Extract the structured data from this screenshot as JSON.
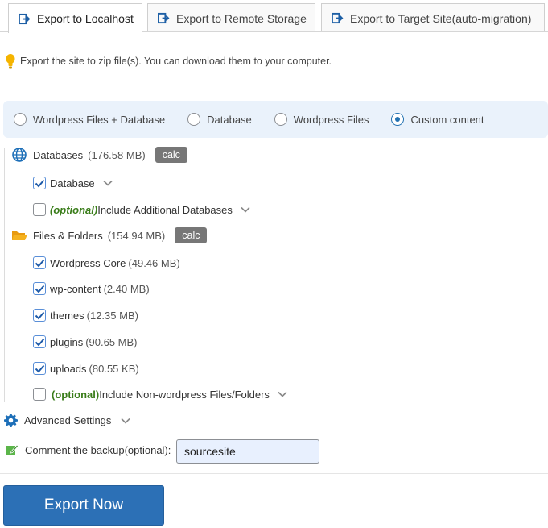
{
  "tabs": [
    {
      "label": "Export to Localhost"
    },
    {
      "label": "Export to Remote Storage"
    },
    {
      "label": "Export to Target Site(auto-migration)"
    }
  ],
  "info_text": "Export the site to zip file(s). You can download them to your computer.",
  "radios": [
    {
      "label": "Wordpress Files + Database",
      "checked": false
    },
    {
      "label": "Database",
      "checked": false
    },
    {
      "label": "Wordpress Files",
      "checked": false
    },
    {
      "label": "Custom content",
      "checked": true
    }
  ],
  "databases": {
    "title": "Databases",
    "size": "(176.58 MB)",
    "calc_label": "calc",
    "items": [
      {
        "label": "Database",
        "checked": true
      },
      {
        "optional": "(optional)",
        "label": "Include Additional Databases",
        "checked": false
      }
    ]
  },
  "files": {
    "title": "Files & Folders",
    "size": "(154.94 MB)",
    "calc_label": "calc",
    "items": [
      {
        "label": "Wordpress Core",
        "size": "(49.46 MB)",
        "checked": true
      },
      {
        "label": "wp-content",
        "size": "(2.40 MB)",
        "checked": true
      },
      {
        "label": "themes",
        "size": "(12.35 MB)",
        "checked": true
      },
      {
        "label": "plugins",
        "size": "(90.65 MB)",
        "checked": true
      },
      {
        "label": "uploads",
        "size": "(80.55 KB)",
        "checked": true
      }
    ],
    "optional_item": {
      "optional": "(optional)",
      "label": "Include Non-wordpress Files/Folders",
      "checked": false
    }
  },
  "advanced_settings": "Advanced Settings",
  "comment": {
    "label": "Comment the backup",
    "optional": "(optional):",
    "value": "sourcesite"
  },
  "export_button": "Export Now",
  "colors": {
    "accent": "#2c70b6",
    "radio_bar_bg": "#eaf2fb",
    "calc_bg": "#777777",
    "optional_green": "#3a7d1a",
    "bulb_yellow": "#f5b400",
    "folder_orange": "#f0a020"
  }
}
